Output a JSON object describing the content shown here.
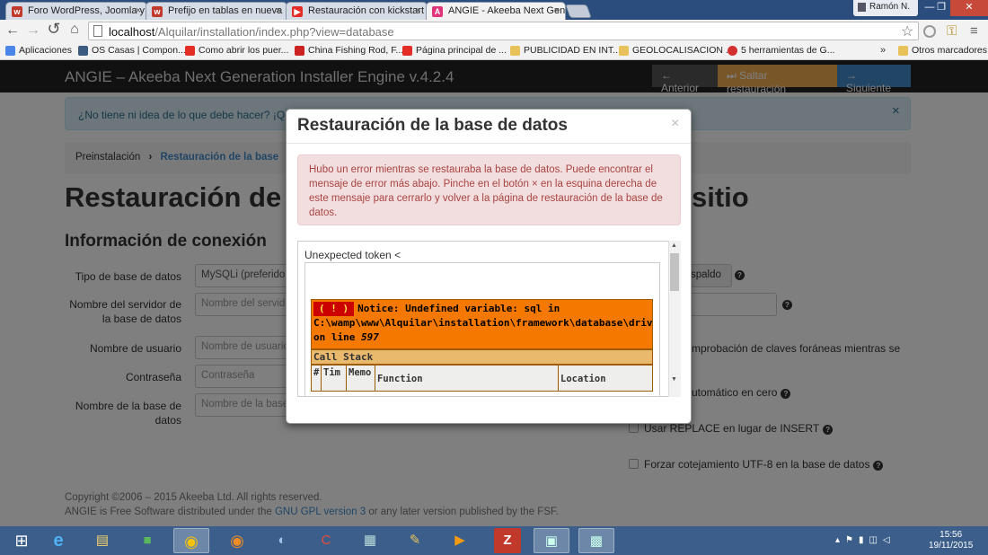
{
  "browser": {
    "tabs": [
      {
        "title": "Foro WordPress, Joomla y",
        "icon": "wordpress-icon",
        "color": "#c0392b",
        "glyph": "w"
      },
      {
        "title": "Prefijo en tablas en nueva",
        "icon": "wordpress-icon",
        "color": "#c0392b",
        "glyph": "w"
      },
      {
        "title": "Restauración con kickstart",
        "icon": "youtube-icon",
        "color": "#e52d27",
        "glyph": "▶"
      },
      {
        "title": "ANGIE - Akeeba Next Gen",
        "icon": "angie-icon",
        "color": "#e0337a",
        "glyph": "A"
      }
    ],
    "user": "Ramón N.",
    "url_host": "localhost",
    "url_path": "/Alquilar/installation/index.php?view=database",
    "bookmarks": [
      {
        "label": "Aplicaciones",
        "color": "#4a86e8"
      },
      {
        "label": "OS Casas | Compon...",
        "color": "#3d5a80"
      },
      {
        "label": "Como abrir los puer...",
        "color": "#e52d27"
      },
      {
        "label": "China Fishing Rod, F...",
        "color": "#cc2222"
      },
      {
        "label": "Página principal de ...",
        "color": "#e52d27"
      },
      {
        "label": "PUBLICIDAD EN INT...",
        "color": "#e8c15a"
      },
      {
        "label": "GEOLOCALISACION ...",
        "color": "#e8c15a"
      },
      {
        "label": "5 herramientas de G...",
        "color": "#d32f2f"
      }
    ],
    "bookmarks_more": "»",
    "other_bookmarks": "Otros marcadores"
  },
  "app": {
    "brand": "ANGIE – Akeeba Next Generation Installer Engine v.4.2.4",
    "prev": "← Anterior",
    "skip": "⏭ Saltar restauración",
    "next": "→ Siguiente",
    "info": "¿No tiene ni idea de lo que debe hacer? ¡Que",
    "info_close": "×",
    "crumb_prev": "Preinstalación",
    "crumb_active": "Restauración de la base",
    "h1_left": "Restauración de",
    "h1_right": "sitio",
    "h2": "Información de conexión",
    "fields": [
      {
        "label": "Tipo de base de datos",
        "value": "MySQLi (preferido"
      },
      {
        "label": "Nombre del servidor de la base de datos",
        "value": "Nombre del servido"
      },
      {
        "label": "Nombre de usuario",
        "value": "Nombre de usuario"
      },
      {
        "label": "Contraseña",
        "value": "Contraseña"
      },
      {
        "label": "Nombre de la base de datos",
        "value": "Nombre de la base"
      }
    ],
    "right_backup": "spaldo",
    "right_fk": "mprobación de claves foráneas mientras se",
    "right_auto": "utomático en cero",
    "right_replace": "Usar REPLACE en lugar de INSERT",
    "right_utf8": "Forzar cotejamiento UTF-8 en la base de datos",
    "footer_line1": "Copyright ©2006 – 2015 Akeeba Ltd. All rights reserved.",
    "footer_l2a": "ANGIE is Free Software distributed under the ",
    "footer_link": "GNU GPL version 3",
    "footer_l2b": " or any later version published by the FSF."
  },
  "modal": {
    "title": "Restauración de la base de datos",
    "close": "×",
    "error": "Hubo un error mientras se restauraba la base de datos. Puede encontrar el mensaje de error más abajo. Pinche en el botón × en la esquina derecha de este mensaje para cerrarlo y volver a la página de restauración de la base de datos.",
    "body_text": "Unexpected token <",
    "notice_bang": "( ! )",
    "notice_text": "Notice: Undefined variable: sql in C:\\wamp\\www\\Alquilar\\installation\\framework\\database\\driver\\mysqli.php on line ",
    "notice_line": "597",
    "callstack": "Call Stack",
    "cols": [
      "#",
      "Tim",
      "Memo",
      "Function",
      "Location"
    ]
  },
  "taskbar": {
    "time": "15:56",
    "date": "19/11/2015"
  }
}
